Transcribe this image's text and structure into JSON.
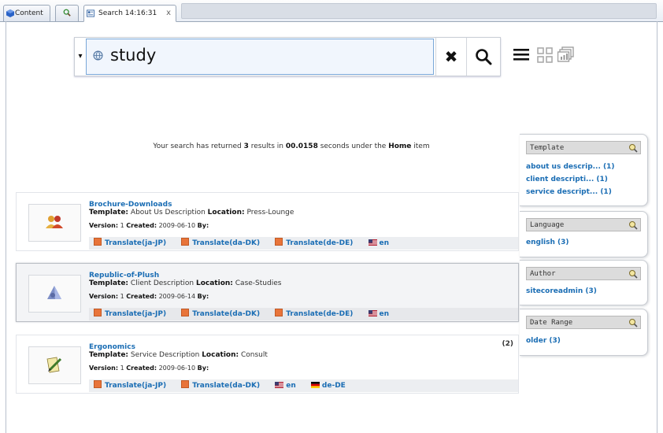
{
  "tabs": [
    {
      "label": "Content"
    },
    {
      "label": ""
    },
    {
      "label": "Search 14:16:31",
      "close": "x"
    }
  ],
  "search": {
    "dropdown_glyph": "▾",
    "value": "study",
    "clear_glyph": "✖"
  },
  "summary": {
    "prefix": "Your search has returned ",
    "count": "3",
    "middle": " results in ",
    "seconds": "00.0158",
    "middle2": " seconds under the ",
    "scope": "Home",
    "suffix": " item"
  },
  "results": [
    {
      "title": "Brochure-Downloads",
      "template_label": "Template:",
      "template": "About Us Description",
      "location_label": "Location:",
      "location": "Press-Lounge",
      "version_label": "Version:",
      "version": "1",
      "created_label": "Created:",
      "created": "2009-06-10",
      "by_label": "By:",
      "by": "",
      "count": "",
      "languages": [
        {
          "label": "Translate(ja-JP)",
          "icon": "translate-icon"
        },
        {
          "label": "Translate(da-DK)",
          "icon": "translate-icon"
        },
        {
          "label": "Translate(de-DE)",
          "icon": "translate-icon"
        },
        {
          "label": "en",
          "icon": "us-flag-icon"
        }
      ]
    },
    {
      "title": "Republic-of-Plush",
      "template_label": "Template:",
      "template": "Client Description",
      "location_label": "Location:",
      "location": "Case-Studies",
      "version_label": "Version:",
      "version": "1",
      "created_label": "Created:",
      "created": "2009-06-14",
      "by_label": "By:",
      "by": "",
      "count": "",
      "languages": [
        {
          "label": "Translate(ja-JP)",
          "icon": "translate-icon"
        },
        {
          "label": "Translate(da-DK)",
          "icon": "translate-icon"
        },
        {
          "label": "Translate(de-DE)",
          "icon": "translate-icon"
        },
        {
          "label": "en",
          "icon": "us-flag-icon"
        }
      ]
    },
    {
      "title": "Ergonomics",
      "template_label": "Template:",
      "template": "Service Description",
      "location_label": "Location:",
      "location": "Consult",
      "version_label": "Version:",
      "version": "1",
      "created_label": "Created:",
      "created": "2009-06-10",
      "by_label": "By:",
      "by": "",
      "count": "(2)",
      "languages": [
        {
          "label": "Translate(ja-JP)",
          "icon": "translate-icon"
        },
        {
          "label": "Translate(da-DK)",
          "icon": "translate-icon"
        },
        {
          "label": "en",
          "icon": "us-flag-icon"
        },
        {
          "label": "de-DE",
          "icon": "de-flag-icon"
        }
      ]
    }
  ],
  "facets": [
    {
      "title": "Template",
      "items": [
        "about us descrip... (1)",
        "client descripti... (1)",
        "service descript... (1)"
      ]
    },
    {
      "title": "Language",
      "items": [
        "english (3)"
      ]
    },
    {
      "title": "Author",
      "items": [
        "sitecoreadmin (3)"
      ]
    },
    {
      "title": "Date Range",
      "items": [
        "older (3)"
      ]
    }
  ],
  "colors": {
    "link": "#1a6db4",
    "input_bg": "#f1f6fd",
    "input_border": "#79a7d8"
  }
}
